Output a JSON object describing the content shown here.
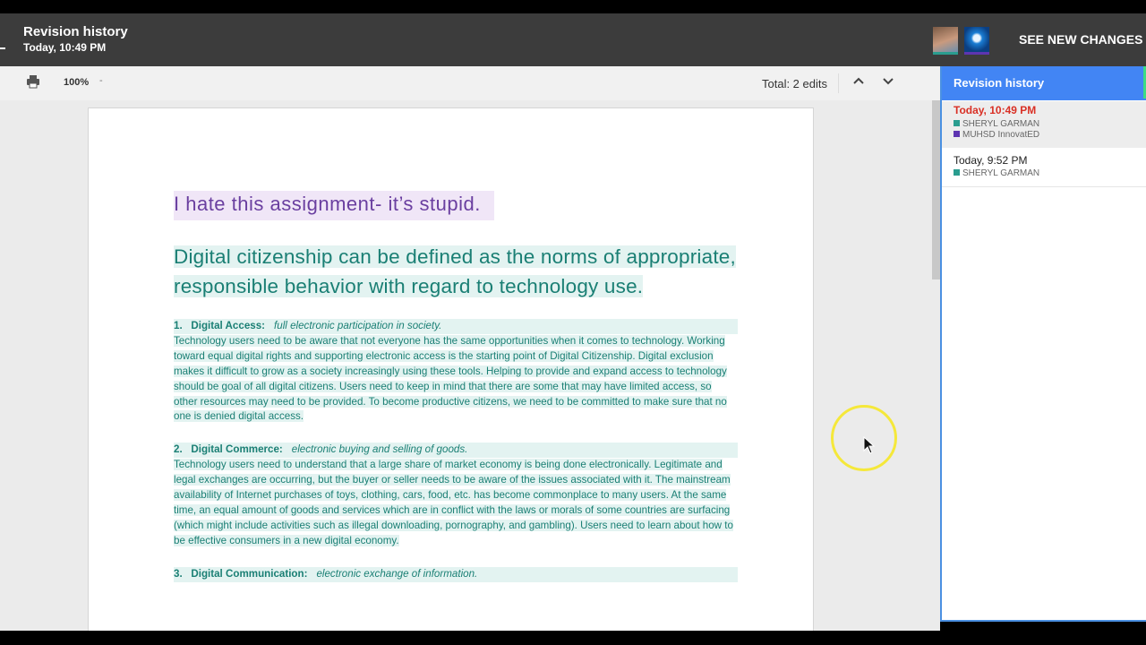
{
  "header": {
    "title": "Revision history",
    "subtitle": "Today, 10:49 PM",
    "see_new_changes": "SEE NEW CHANGES"
  },
  "toolbar": {
    "zoom": "100%",
    "zoom_caret": "-",
    "total_edits": "Total: 2 edits"
  },
  "document": {
    "line1": "I hate this assignment- it’s stupid.",
    "heading": "Digital citizenship can be defined as the norms of appropriate, responsible behavior with regard to technology use.",
    "sections": [
      {
        "num": "1.",
        "title": "Digital Access:",
        "subtitle": "full electronic participation in society.",
        "body": "Technology users need to be aware that not everyone has the same opportunities when it comes to technology.  Working toward equal digital rights and supporting electronic access is the starting point of Digital Citizenship. Digital exclusion makes it difficult to grow as a society increasingly using these tools. Helping to provide and expand access to technology should be goal of all digital citizens.  Users need to keep in mind that there are some that may have limited access, so other resources may need to be provided.  To become productive citizens, we need to be committed to make sure that no one is denied digital access."
      },
      {
        "num": "2.",
        "title": "Digital Commerce:",
        "subtitle": "electronic buying and selling of goods.",
        "body": "Technology users need to understand that a large share of market economy is being done electronically. Legitimate and legal exchanges are occurring, but the buyer or seller needs to be aware of the issues associated with it. The mainstream availability of Internet purchases of toys, clothing, cars, food, etc. has become commonplace to many users. At the same time, an equal amount of goods and services which are in conflict with the laws or morals of some countries are surfacing (which might include activities such as illegal downloading, pornography, and gambling). Users need to learn about how to be effective consumers in a new digital economy."
      },
      {
        "num": "3.",
        "title": "Digital Communication:",
        "subtitle": "electronic exchange of information."
      }
    ]
  },
  "revision_panel": {
    "title": "Revision history",
    "revisions": [
      {
        "time": "Today, 10:49 PM",
        "authors": [
          {
            "name": "SHERYL GARMAN",
            "color": "#2a9d8f"
          },
          {
            "name": "MUHSD InnovatED",
            "color": "#5e35b1"
          }
        ]
      },
      {
        "time": "Today, 9:52 PM",
        "authors": [
          {
            "name": "SHERYL GARMAN",
            "color": "#2a9d8f"
          }
        ]
      }
    ]
  },
  "colors": {
    "accent_blue": "#4285f4",
    "current_revision_red": "#d93025",
    "author1": "#2a9d8f",
    "author2": "#5e35b1",
    "deleted_text_purple": "#6a3fa0",
    "added_text_teal": "#1a7f74"
  }
}
